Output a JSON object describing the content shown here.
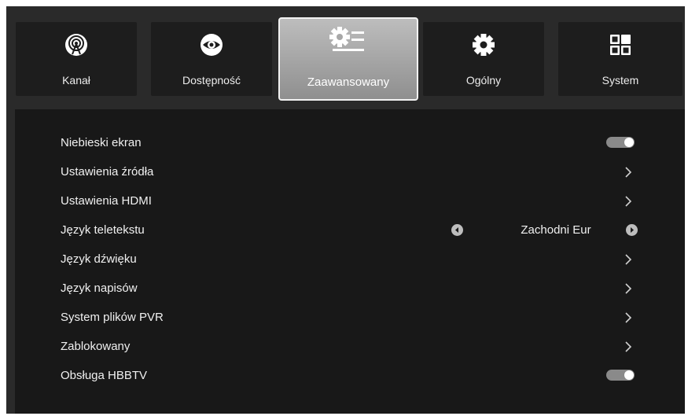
{
  "tabs": [
    {
      "label": "Kanał",
      "icon": "antenna-icon"
    },
    {
      "label": "Dostępność",
      "icon": "eye-icon"
    },
    {
      "label": "Zaawansowany",
      "icon": "advanced-settings-icon"
    },
    {
      "label": "Ogólny",
      "icon": "gear-icon"
    },
    {
      "label": "System",
      "icon": "system-grid-icon"
    }
  ],
  "active_tab": "Zaawansowany",
  "settings": {
    "blue_screen": {
      "label": "Niebieski ekran",
      "enabled": true
    },
    "source_settings": {
      "label": "Ustawienia źródła"
    },
    "hdmi_settings": {
      "label": "Ustawienia HDMI"
    },
    "teletext_language": {
      "label": "Język teletekstu",
      "value": "Zachodni Eur"
    },
    "audio_language": {
      "label": "Język dźwięku"
    },
    "subtitle_language": {
      "label": "Język napisów"
    },
    "pvr_filesystem": {
      "label": "System plików PVR"
    },
    "locked": {
      "label": "Zablokowany"
    },
    "hbbtv_support": {
      "label": "Obsługa HBBTV",
      "enabled": true
    }
  },
  "colors": {
    "background": "#2a2a2a",
    "panel": "#181818",
    "tab": "#1d1d1d",
    "active_tab": "#a8a8a8",
    "toggle_on": "#8a8a8a"
  }
}
